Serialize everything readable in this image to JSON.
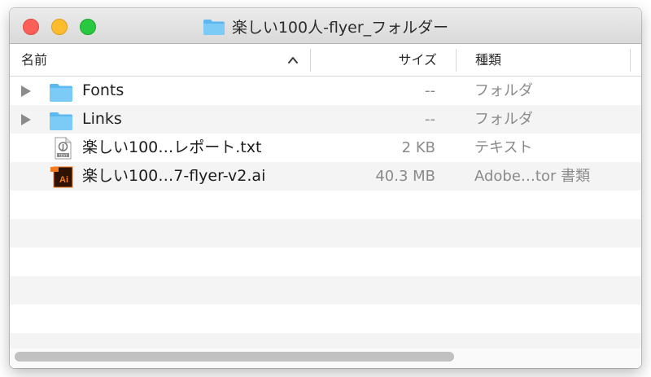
{
  "window": {
    "title": "楽しい100人-flyer_フォルダー"
  },
  "columns": {
    "name": "名前",
    "size": "サイズ",
    "kind": "種類",
    "sort_indicator": "^"
  },
  "files": [
    {
      "name": "Fonts",
      "size": "--",
      "kind": "フォルダ",
      "icon": "folder-icon"
    },
    {
      "name": "Links",
      "size": "--",
      "kind": "フォルダ",
      "icon": "folder-icon"
    },
    {
      "name": "楽しい100…レポート.txt",
      "size": "2 KB",
      "kind": "テキスト",
      "icon": "text-file-icon"
    },
    {
      "name": "楽しい100…7-flyer-v2.ai",
      "size": "40.3 MB",
      "kind": "Adobe…tor 書類",
      "icon": "illustrator-file-icon"
    }
  ],
  "icons": {
    "text_badge": "TEXT",
    "ai_badge": "Ai"
  },
  "colors": {
    "folder": "#6cc4f5",
    "ai_background": "#2e1300",
    "ai_accent": "#f27b1f"
  }
}
